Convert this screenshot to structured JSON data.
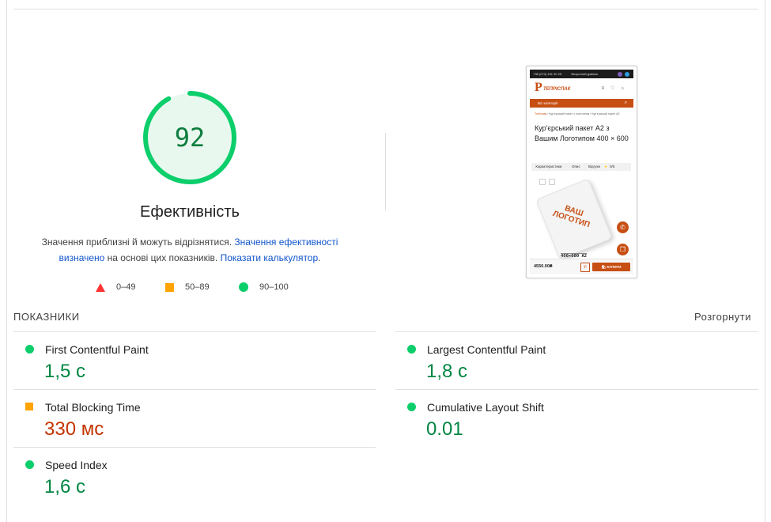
{
  "gauge": {
    "score": "92",
    "score_fraction": 0.92,
    "title": "Ефективність",
    "color": "#0cce6b"
  },
  "description": {
    "text1": "Значення приблизні й можуть відрізнятися. ",
    "link1": "Значення ефективності визначено",
    "text2": " на основі цих показників. ",
    "link2": "Показати калькулятор",
    "text3": "."
  },
  "legend": {
    "fail": "0–49",
    "average": "50–89",
    "pass": "90–100"
  },
  "thumbnail": {
    "phone": "+38 (073) 431 30 25",
    "callback": "Зворотний дзвінок",
    "logo_text": "ТЕПРІСПАК",
    "catalog": "Всі категорії",
    "crumbs": [
      "Tеп!іспак",
      "Кур'єрський пакет з логотипом",
      "Кур'єрський пакет А2"
    ],
    "title": "Кур'єрський пакет А2 з Вашим Логотипом 400 × 600",
    "tabs": [
      "Характеристики",
      "Опис",
      "Відгуки",
      "0/5"
    ],
    "bag_text": "ВАШ ЛОГОТИП",
    "code": "400×600 А2",
    "price": "4550.00₴",
    "buy": "КУПИТИ"
  },
  "metrics_header": {
    "label": "ПОКАЗНИКИ",
    "expand": "Розгорнути"
  },
  "metrics": [
    {
      "name": "First Contentful Paint",
      "value": "1,5 с",
      "status": "pass"
    },
    {
      "name": "Largest Contentful Paint",
      "value": "1,8 с",
      "status": "pass"
    },
    {
      "name": "Total Blocking Time",
      "value": "330 мс",
      "status": "average"
    },
    {
      "name": "Cumulative Layout Shift",
      "value": "0.01",
      "status": "pass"
    },
    {
      "name": "Speed Index",
      "value": "1,6 с",
      "status": "pass"
    }
  ],
  "colors": {
    "pass": "#0cce6b",
    "average": "#ffa400",
    "fail": "#ff3333",
    "pass_text": "#018642",
    "average_text": "#c33300",
    "link": "#1155cc"
  }
}
